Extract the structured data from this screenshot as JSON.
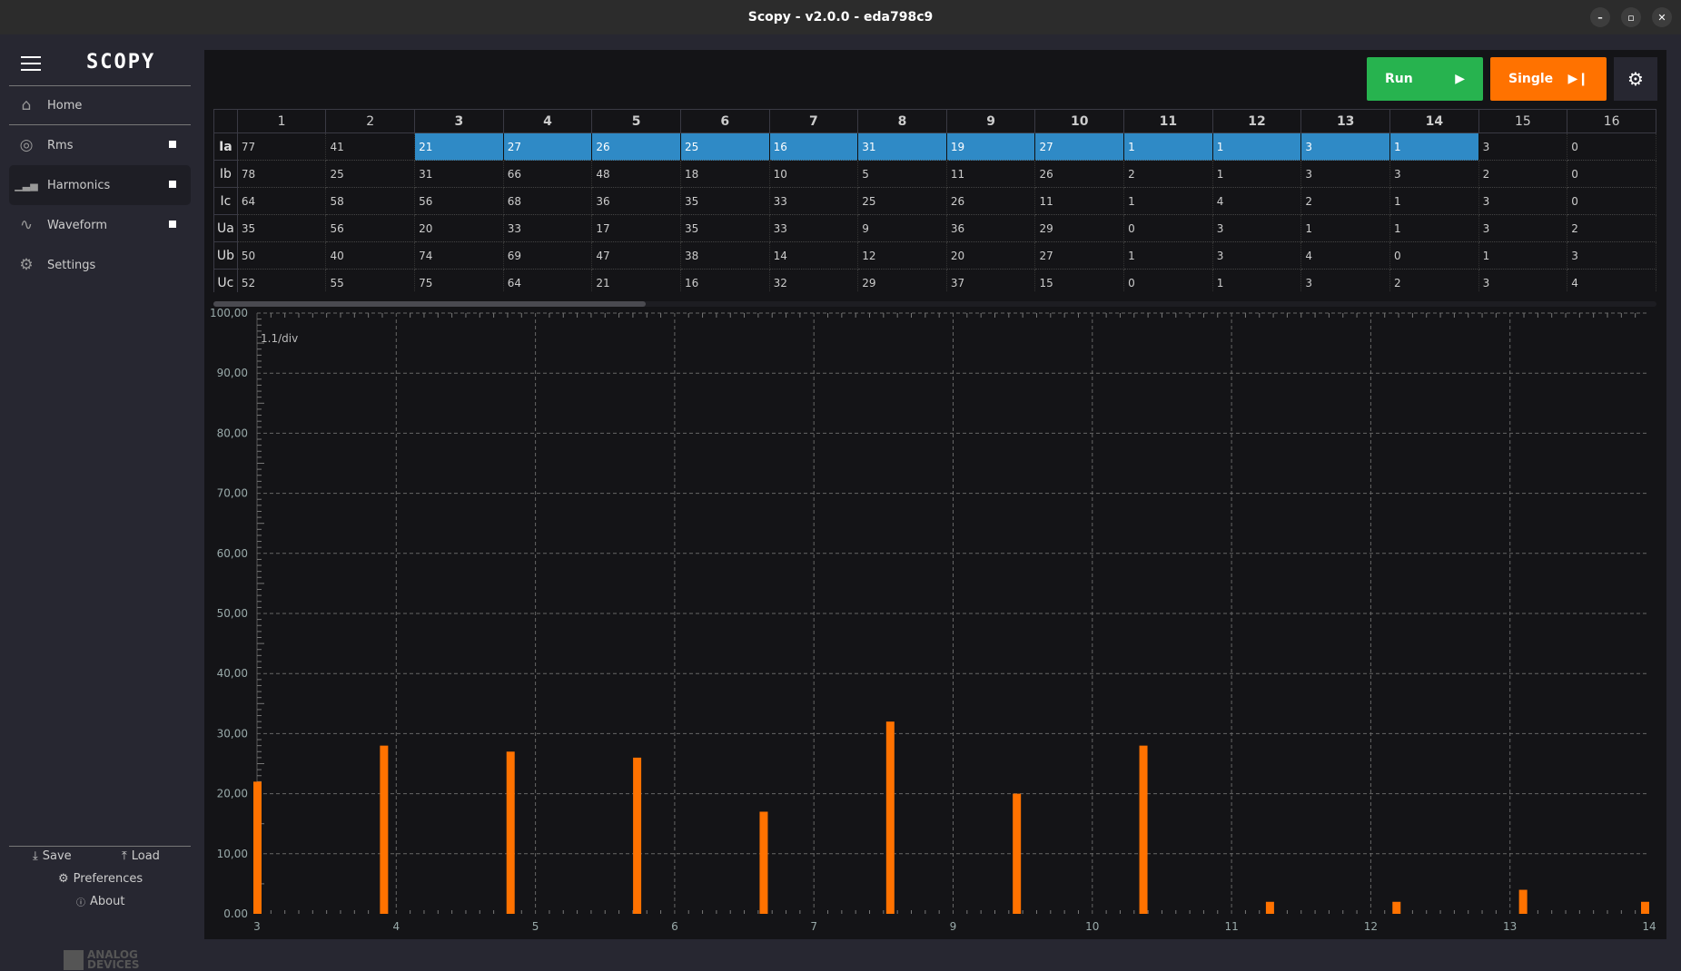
{
  "window": {
    "title": "Scopy - v2.0.0 - eda798c9",
    "controls": [
      "–",
      "▫",
      "✕"
    ]
  },
  "sidebar": {
    "logo": "SCOPY",
    "items": [
      {
        "label": "Home",
        "icon": "home-icon",
        "glyph": "⌂",
        "dot": false
      },
      {
        "label": "Rms",
        "icon": "rms-icon",
        "glyph": "◎",
        "dot": true
      },
      {
        "label": "Harmonics",
        "icon": "harmonics-icon",
        "glyph": "▁▃▅",
        "dot": true,
        "selected": true
      },
      {
        "label": "Waveform",
        "icon": "waveform-icon",
        "glyph": "∿",
        "dot": true
      },
      {
        "label": "Settings",
        "icon": "gear-icon",
        "glyph": "⚙",
        "dot": false
      }
    ],
    "save": "Save",
    "load": "Load",
    "preferences": "Preferences",
    "about": "About",
    "vendor_logo": "ANALOG DEVICES"
  },
  "toolbar": {
    "run": "Run",
    "single": "Single",
    "run_color": "#27b34f",
    "single_color": "#ff7200"
  },
  "table": {
    "columns": [
      "1",
      "2",
      "3",
      "4",
      "5",
      "6",
      "7",
      "8",
      "9",
      "10",
      "11",
      "12",
      "13",
      "14",
      "15",
      "16"
    ],
    "bold_columns": [
      "3",
      "4",
      "5",
      "6",
      "7",
      "8",
      "9",
      "10",
      "11",
      "12",
      "13",
      "14"
    ],
    "selected_row": "Ia",
    "selection_color": "#2f8ac6",
    "rows": [
      {
        "label": "Ia",
        "values": [
          "77",
          "41",
          "21",
          "27",
          "26",
          "25",
          "16",
          "31",
          "19",
          "27",
          "1",
          "1",
          "3",
          "1",
          "3",
          "0"
        ]
      },
      {
        "label": "Ib",
        "values": [
          "78",
          "25",
          "31",
          "66",
          "48",
          "18",
          "10",
          "5",
          "11",
          "26",
          "2",
          "1",
          "3",
          "3",
          "2",
          "0"
        ]
      },
      {
        "label": "Ic",
        "values": [
          "64",
          "58",
          "56",
          "68",
          "36",
          "35",
          "33",
          "25",
          "26",
          "11",
          "1",
          "4",
          "2",
          "1",
          "3",
          "0"
        ]
      },
      {
        "label": "Ua",
        "values": [
          "35",
          "56",
          "20",
          "33",
          "17",
          "35",
          "33",
          "9",
          "36",
          "29",
          "0",
          "3",
          "1",
          "1",
          "3",
          "2"
        ]
      },
      {
        "label": "Ub",
        "values": [
          "50",
          "40",
          "74",
          "69",
          "47",
          "38",
          "14",
          "12",
          "20",
          "27",
          "1",
          "3",
          "4",
          "0",
          "1",
          "3"
        ]
      },
      {
        "label": "Uc",
        "values": [
          "52",
          "55",
          "75",
          "64",
          "21",
          "16",
          "32",
          "29",
          "37",
          "15",
          "0",
          "1",
          "3",
          "2",
          "3",
          "4"
        ]
      }
    ]
  },
  "chart_data": {
    "type": "bar",
    "xlim": [
      3,
      14
    ],
    "ylim": [
      0,
      100
    ],
    "grid": true,
    "div_label": "1.1/div",
    "xticks": [
      "3",
      "4",
      "5",
      "6",
      "7",
      "9",
      "10",
      "11",
      "12",
      "13",
      "14"
    ],
    "yticks": [
      "0.00",
      "10,00",
      "20,00",
      "30,00",
      "40,00",
      "50,00",
      "60,00",
      "70,00",
      "80,00",
      "90,00",
      "100,00"
    ],
    "x": [
      3,
      4,
      5,
      6,
      7,
      8,
      9,
      10,
      11,
      12,
      13,
      14
    ],
    "values": [
      22,
      28,
      27,
      26,
      17,
      32,
      20,
      28,
      2,
      2,
      4,
      2
    ],
    "bar_color": "#ff7200"
  }
}
